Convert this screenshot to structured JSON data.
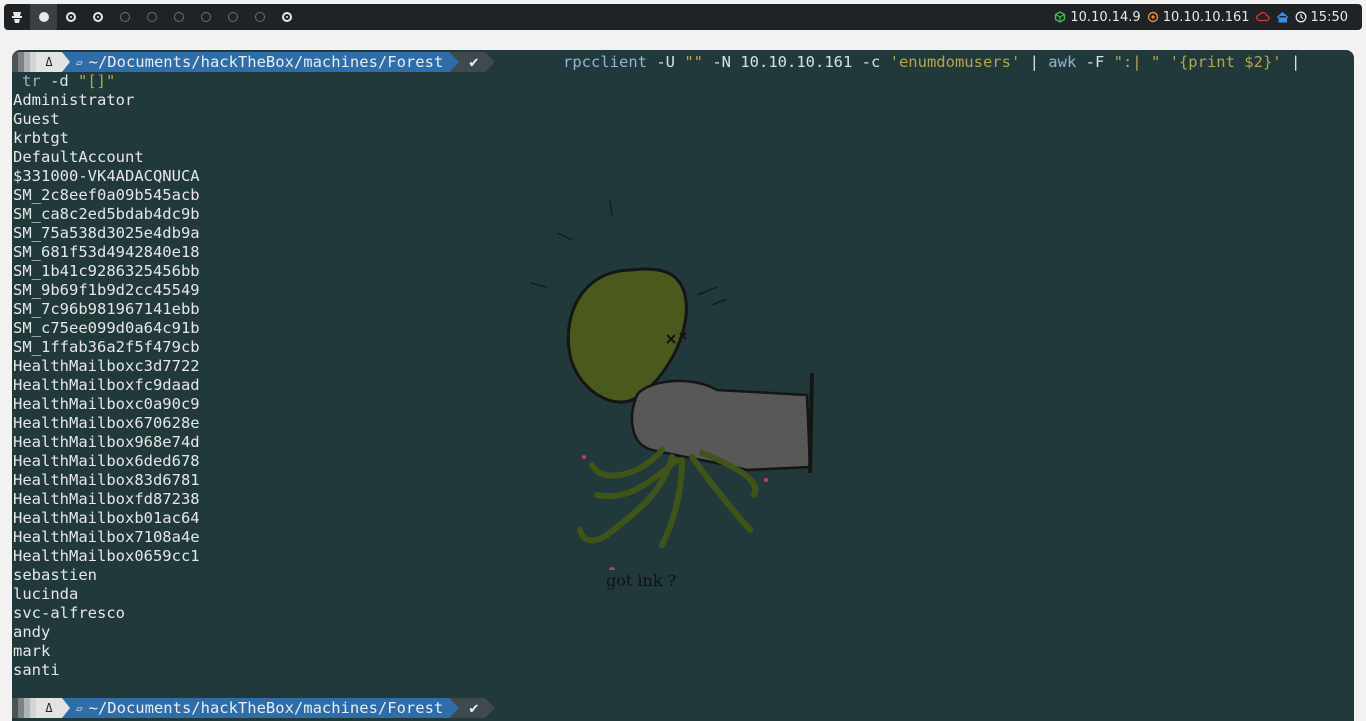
{
  "topbar": {
    "workspaces": [
      "1",
      "2",
      "3",
      "4",
      "5",
      "6",
      "7",
      "8",
      "9",
      "10"
    ],
    "status": {
      "vpn_ip": "10.10.14.9",
      "target_ip": "10.10.10.161",
      "clock": "15:50"
    },
    "colors": {
      "vpn": "#3fbf4f",
      "target": "#f08b2a",
      "cloud": "#d33a3a",
      "home": "#3a8ee6"
    }
  },
  "terminal": {
    "prompt": {
      "os_glyph": "Δ",
      "folder_glyph": "▱",
      "path": "~/Documents/hackTheBox/machines/Forest",
      "ok_glyph": "✔"
    },
    "command": {
      "bin": "rpcclient",
      "args1": " -U ",
      "user_str": "\"\"",
      "args2": " -N 10.10.10.161 -c ",
      "cmd_str": "'enumdomusers'",
      "pipe1": " | ",
      "awk": "awk",
      "awk_args": " -F ",
      "sep_str": "\":| \"",
      "space": " ",
      "prog_str": "'{print $2}'",
      "pipe2": " |",
      "tr": "tr",
      "tr_args": " -d ",
      "tr_str": "\"[]\""
    },
    "output_lines": [
      "Administrator",
      "Guest",
      "krbtgt",
      "DefaultAccount",
      "$331000-VK4ADACQNUCA",
      "SM_2c8eef0a09b545acb",
      "SM_ca8c2ed5bdab4dc9b",
      "SM_75a538d3025e4db9a",
      "SM_681f53d4942840e18",
      "SM_1b41c9286325456bb",
      "SM_9b69f1b9d2cc45549",
      "SM_7c96b981967141ebb",
      "SM_c75ee099d0a64c91b",
      "SM_1ffab36a2f5f479cb",
      "HealthMailboxc3d7722",
      "HealthMailboxfc9daad",
      "HealthMailboxc0a90c9",
      "HealthMailbox670628e",
      "HealthMailbox968e74d",
      "HealthMailbox6ded678",
      "HealthMailbox83d6781",
      "HealthMailboxfd87238",
      "HealthMailboxb01ac64",
      "HealthMailbox7108a4e",
      "HealthMailbox0659cc1",
      "sebastien",
      "lucinda",
      "svc-alfresco",
      "andy",
      "mark",
      "santi"
    ],
    "wallpaper_caption": "got ink ?"
  }
}
